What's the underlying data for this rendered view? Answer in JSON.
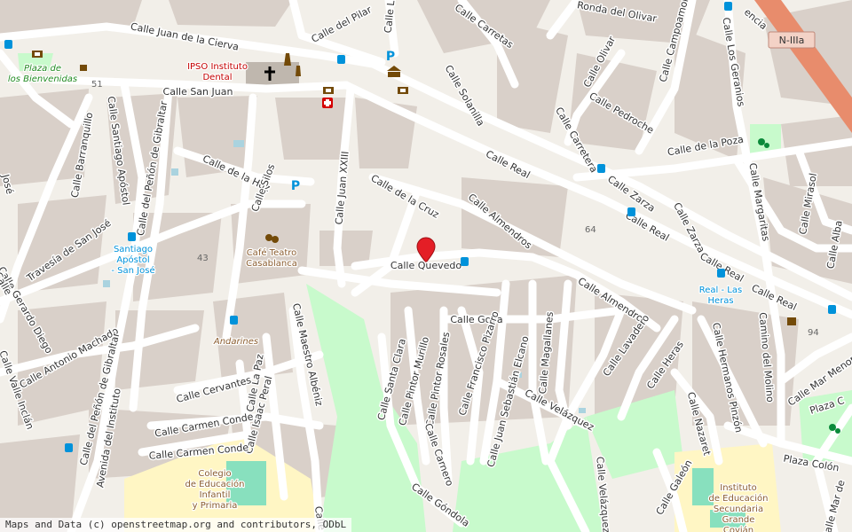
{
  "colors": {
    "land": "#f2efe9",
    "block": "#d9d0c9",
    "road": "#ffffff",
    "roadEdge": "#cfc6bd",
    "motorway": "#e88c6c",
    "park": "#c8facc",
    "pitch": "#88e0be",
    "school": "#fff6c4",
    "water": "#aad3df",
    "poiText": "#8a5c2e",
    "transport": "#0092da",
    "healthText": "#c40000",
    "marker": "#e41e26"
  },
  "streets": [
    {
      "name": "Calle Juan de la Cierva"
    },
    {
      "name": "Calle San Juan"
    },
    {
      "name": "Calle del Pilar"
    },
    {
      "name": "Calle Lib"
    },
    {
      "name": "Calle Carretas"
    },
    {
      "name": "Ronda del Olivar"
    },
    {
      "name": "Calle Campoamor"
    },
    {
      "name": "Calle Los Geranios"
    },
    {
      "name": "Calle Olivar"
    },
    {
      "name": "Calle Pedroche"
    },
    {
      "name": "Calle Solanilla"
    },
    {
      "name": "Calle Carretera"
    },
    {
      "name": "Calle de la Poza"
    },
    {
      "name": "Calle Real"
    },
    {
      "name": "Calle Real"
    },
    {
      "name": "Calle Real"
    },
    {
      "name": "Calle Real"
    },
    {
      "name": "Calle Zarza"
    },
    {
      "name": "Calle Zarza"
    },
    {
      "name": "Calle Margaritas"
    },
    {
      "name": "Calle Mirasol"
    },
    {
      "name": "Calle Alba"
    },
    {
      "name": "Calle Barranquillo"
    },
    {
      "name": "Calle Santiago Apóstol"
    },
    {
      "name": "Calle del Peñón de Gibraltar"
    },
    {
      "name": "Calle de la Hoz"
    },
    {
      "name": "Calle Silos"
    },
    {
      "name": "Calle Juan XXIII"
    },
    {
      "name": "Calle de la Cruz"
    },
    {
      "name": "Calle Almendros"
    },
    {
      "name": "Calle Almendros"
    },
    {
      "name": "Travesía de San José"
    },
    {
      "name": "Calle Quevedo"
    },
    {
      "name": "Calle Goya"
    },
    {
      "name": "Calle Gerardo Diego"
    },
    {
      "name": "Calle Antonio Machado"
    },
    {
      "name": "Calle del Peñón de Gibraltar"
    },
    {
      "name": "Calle Valle Inclán"
    },
    {
      "name": "Calle Maestro Albéniz"
    },
    {
      "name": "Calle La Paz"
    },
    {
      "name": "Calle Isaac Peral"
    },
    {
      "name": "Calle Cervantes"
    },
    {
      "name": "Calle Carmen Conde"
    },
    {
      "name": "Calle Carmen Conde"
    },
    {
      "name": "Avenida del Instituto"
    },
    {
      "name": "Calle Santa Clara"
    },
    {
      "name": "Calle Pintor Murillo"
    },
    {
      "name": "Calle Pintor Rosales"
    },
    {
      "name": "Calle Francisco Pizarro"
    },
    {
      "name": "Calle Carnero"
    },
    {
      "name": "Calle Juan Sebastián Elcano"
    },
    {
      "name": "Calle Magallanes"
    },
    {
      "name": "Calle Velázquez"
    },
    {
      "name": "Calle Velázquez"
    },
    {
      "name": "Calle Lavadero"
    },
    {
      "name": "Calle Heras"
    },
    {
      "name": "Calle Hermanos Pinzón"
    },
    {
      "name": "Camino del Molino"
    },
    {
      "name": "Calle Mar Menor"
    },
    {
      "name": "Calle Nazaret"
    },
    {
      "name": "Calle Galeón"
    },
    {
      "name": "Plaza Colón"
    },
    {
      "name": "Plaza C"
    },
    {
      "name": "Calle Mar de"
    },
    {
      "name": "Calle Góndola"
    },
    {
      "name": "Calle C"
    },
    {
      "name": "José"
    },
    {
      "name": "Calle"
    },
    {
      "name": "encia"
    }
  ],
  "pois": [
    {
      "name": "Plaza de los Bienvenidas"
    },
    {
      "name": "IPSO Instituto Dental"
    },
    {
      "name": "Santiago Apóstol - San José"
    },
    {
      "name": "Café Teatro Casablanca"
    },
    {
      "name": "Andarines"
    },
    {
      "name": "Real - Las Heras"
    },
    {
      "name": "Colegio de Educación Infantil y Primaria"
    },
    {
      "name": "Instituto de Educación Secundaria Grande Covián"
    }
  ],
  "housenumbers": [
    "51",
    "43",
    "64",
    "94"
  ],
  "road_ref": "N-IIIa",
  "attribution": "Maps and Data (c) openstreetmap.org and contributors, ODbL"
}
